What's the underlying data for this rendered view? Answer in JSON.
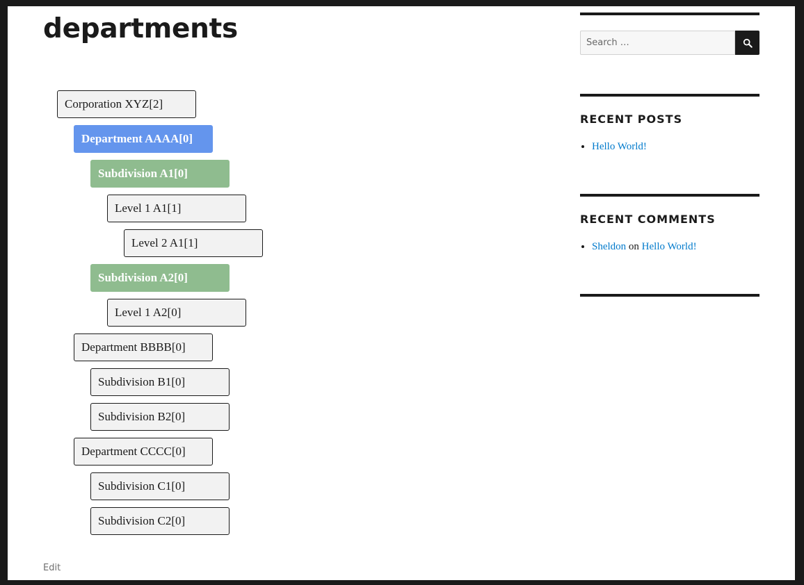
{
  "page": {
    "title": "departments",
    "edit_label": "Edit"
  },
  "tree": {
    "nodes": [
      {
        "label": "Corporation XYZ[2]",
        "depth": 0,
        "style": "default"
      },
      {
        "label": "Department AAAA[0]",
        "depth": 1,
        "style": "blue"
      },
      {
        "label": "Subdivision A1[0]",
        "depth": 2,
        "style": "green"
      },
      {
        "label": "Level 1 A1[1]",
        "depth": 3,
        "style": "default"
      },
      {
        "label": "Level 2 A1[1]",
        "depth": 4,
        "style": "default"
      },
      {
        "label": "Subdivision A2[0]",
        "depth": 2,
        "style": "green"
      },
      {
        "label": "Level 1 A2[0]",
        "depth": 3,
        "style": "default"
      },
      {
        "label": "Department BBBB[0]",
        "depth": 1,
        "style": "default"
      },
      {
        "label": "Subdivision B1[0]",
        "depth": 2,
        "style": "default"
      },
      {
        "label": "Subdivision B2[0]",
        "depth": 2,
        "style": "default"
      },
      {
        "label": "Department CCCC[0]",
        "depth": 1,
        "style": "default"
      },
      {
        "label": "Subdivision C1[0]",
        "depth": 2,
        "style": "default"
      },
      {
        "label": "Subdivision C2[0]",
        "depth": 2,
        "style": "default"
      }
    ]
  },
  "sidebar": {
    "search": {
      "placeholder": "Search …",
      "button_icon": "search-icon"
    },
    "recent_posts": {
      "title": "RECENT POSTS",
      "items": [
        {
          "link": "Hello World!"
        }
      ]
    },
    "recent_comments": {
      "title": "RECENT COMMENTS",
      "items": [
        {
          "author": "Sheldon",
          "connector": "on",
          "post": "Hello World!"
        }
      ]
    }
  },
  "colors": {
    "selected": "#6495ed",
    "highlight": "#8fbc8f",
    "link": "#007acc",
    "text": "#1a1a1a",
    "frame": "#1a1a1a"
  }
}
